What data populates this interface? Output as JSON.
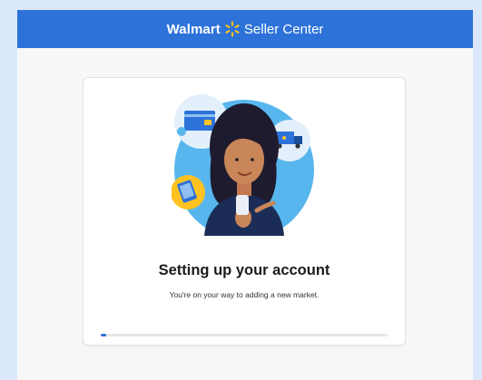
{
  "header": {
    "brand": "Walmart",
    "product": "Seller Center",
    "logo_icon": "walmart-spark-icon"
  },
  "setup": {
    "title": "Setting up your account",
    "subtitle": "You're on your way to adding a new market.",
    "progress_fraction": 0.02,
    "illustration_icon": "seller-onboarding-illustration"
  },
  "colors": {
    "brand_blue": "#2d72d9",
    "spark_yellow": "#ffc220",
    "page_background": "#dbe8fb"
  }
}
